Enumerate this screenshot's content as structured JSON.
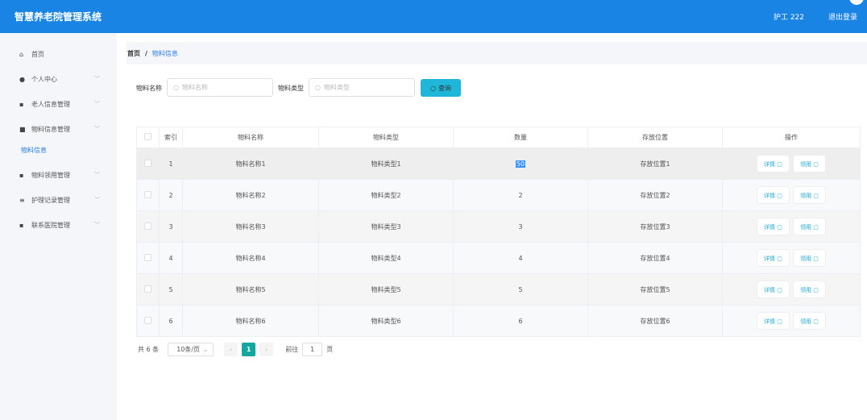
{
  "header": {
    "title": "智慧养老院管理系统",
    "user": "护工 222",
    "logout": "退出登录"
  },
  "sidebar": {
    "items": [
      {
        "label": "首页",
        "icon": "home-icon",
        "glyph": "⌂"
      },
      {
        "label": "个人中心",
        "icon": "user-icon",
        "glyph": "●"
      },
      {
        "label": "老人信息管理",
        "icon": "grid-icon",
        "glyph": "▪"
      },
      {
        "label": "物料信息管理",
        "icon": "monitor-icon",
        "glyph": "■"
      },
      {
        "label": "物料领用管理",
        "icon": "grid-icon",
        "glyph": "▪"
      },
      {
        "label": "护理记录管理",
        "icon": "list-icon",
        "glyph": "≡"
      },
      {
        "label": "联系医院管理",
        "icon": "grid-icon",
        "glyph": "▪"
      }
    ],
    "sub_active": "物料信息"
  },
  "breadcrumb": {
    "home": "首页",
    "sep": "/",
    "current": "物料信息"
  },
  "search": {
    "name_label": "物料名称",
    "name_placeholder": "物料名称",
    "type_label": "物料类型",
    "type_placeholder": "物料类型",
    "query": "查询"
  },
  "table": {
    "headers": [
      "索引",
      "物料名称",
      "物料类型",
      "数量",
      "存放位置",
      "操作"
    ],
    "rows": [
      {
        "index": "1",
        "name": "物料名称1",
        "type": "物料类型1",
        "qty": "50",
        "loc": "存放位置1"
      },
      {
        "index": "2",
        "name": "物料名称2",
        "type": "物料类型2",
        "qty": "2",
        "loc": "存放位置2"
      },
      {
        "index": "3",
        "name": "物料名称3",
        "type": "物料类型3",
        "qty": "3",
        "loc": "存放位置3"
      },
      {
        "index": "4",
        "name": "物料名称4",
        "type": "物料类型4",
        "qty": "4",
        "loc": "存放位置4"
      },
      {
        "index": "5",
        "name": "物料名称5",
        "type": "物料类型5",
        "qty": "5",
        "loc": "存放位置5"
      },
      {
        "index": "6",
        "name": "物料名称6",
        "type": "物料类型6",
        "qty": "6",
        "loc": "存放位置6"
      }
    ],
    "detail": "详情",
    "use": "领用"
  },
  "pagination": {
    "total": "共 6 条",
    "page_size": "10条/页",
    "current": "1",
    "goto_label": "前往",
    "goto_value": "1",
    "page_suffix": "页"
  }
}
